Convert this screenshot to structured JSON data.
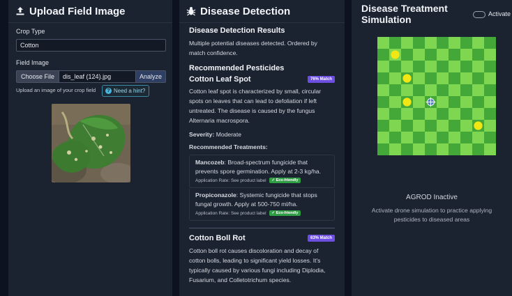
{
  "upload": {
    "title": "Upload Field Image",
    "crop_type_label": "Crop Type",
    "crop_value": "Cotton",
    "field_image_label": "Field Image",
    "choose_file": "Choose File",
    "file_name": "dis_leaf (124).jpg",
    "analyze": "Analyze",
    "helper_text": "Upload an image of your crop field",
    "hint_button": "Need a hint?"
  },
  "detection": {
    "title": "Disease Detection",
    "results_heading": "Disease Detection Results",
    "results_text": "Multiple potential diseases detected. Ordered by match confidence.",
    "pesticides_heading": "Recommended Pesticides",
    "diseases": [
      {
        "name": "Cotton Leaf Spot",
        "match": "76% Match",
        "description": "Cotton leaf spot is characterized by small, circular spots on leaves that can lead to defoliation if left untreated. The disease is caused by the fungus Alternaria macrospora.",
        "severity_label": "Severity:",
        "severity_value": "Moderate",
        "treatments_label": "Recommended Treatments:",
        "treatments": [
          {
            "name": "Mancozeb",
            "text": ": Broad-spectrum fungicide that prevents spore germination. Apply at 2-3 kg/ha.",
            "rate": "Application Rate: See product label",
            "badge": "Eco-friendly"
          },
          {
            "name": "Propiconazole",
            "text": ": Systemic fungicide that stops fungal growth. Apply at 500-750 ml/ha.",
            "rate": "Application Rate: See product label",
            "badge": "Eco-friendly"
          }
        ]
      },
      {
        "name": "Cotton Boll Rot",
        "match": "63% Match",
        "description": "Cotton boll rot causes discoloration and decay of cotton bolls, leading to significant yield losses. It's typically caused by various fungi including Diplodia, Fusarium, and Colletotrichum species."
      }
    ]
  },
  "simulation": {
    "title": "Disease Treatment Simulation",
    "toggle_label": "Activate",
    "status_title": "AGROD Inactive",
    "status_text": "Activate drone simulation to practice applying pesticides to diseased areas",
    "grid_size": 10,
    "diseased_cells": [
      [
        1,
        1
      ],
      [
        2,
        3
      ],
      [
        2,
        5
      ],
      [
        8,
        7
      ]
    ],
    "drone_cell": [
      4,
      5
    ],
    "colors": {
      "light": "#7fd650",
      "dark": "#43a838",
      "disease": "#f2e615"
    }
  }
}
